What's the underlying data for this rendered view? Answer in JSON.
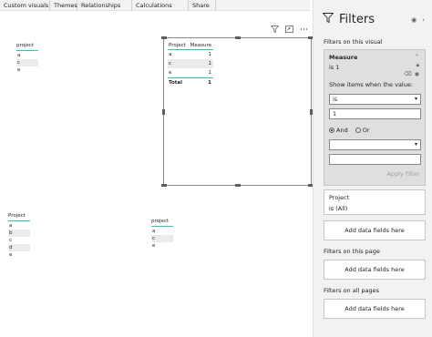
{
  "ribbon": {
    "tabs": [
      "Custom visuals",
      "Themes",
      "Relationships",
      "Calculations",
      "Share"
    ]
  },
  "slicers": {
    "top_left": {
      "header": "project",
      "items": [
        "a",
        "c",
        "e"
      ]
    },
    "bottom_left": {
      "header": "Project",
      "items": [
        "a",
        "b",
        "c",
        "d",
        "e"
      ]
    },
    "bottom_mid": {
      "header": "project",
      "items": [
        "a",
        "c",
        "e"
      ]
    }
  },
  "table_visual": {
    "headers": [
      "Project",
      "Measure"
    ],
    "rows": [
      [
        "a",
        "1"
      ],
      [
        "c",
        "1"
      ],
      [
        "e",
        "1"
      ]
    ],
    "total": [
      "Total",
      "1"
    ]
  },
  "visual_toolbar": {
    "icons": [
      "filter-icon",
      "focus-mode-icon",
      "more-options-icon"
    ]
  },
  "filters": {
    "title": "Filters",
    "on_this_visual_label": "Filters on this visual",
    "measure_card": {
      "title": "Measure",
      "summary": "is 1",
      "show_items_label": "Show items when the value:",
      "condition1": "is",
      "value1": "1",
      "and_label": "And",
      "or_label": "Or",
      "condition2": "",
      "value2": "",
      "apply_label": "Apply filter"
    },
    "project_card": {
      "title": "Project",
      "summary": "is (All)"
    },
    "add_fields_label": "Add data fields here",
    "on_this_page_label": "Filters on this page",
    "on_all_pages_label": "Filters on all pages"
  },
  "colors": {
    "accent": "#2ec4b6",
    "pane_bg": "#f3f2f1"
  }
}
